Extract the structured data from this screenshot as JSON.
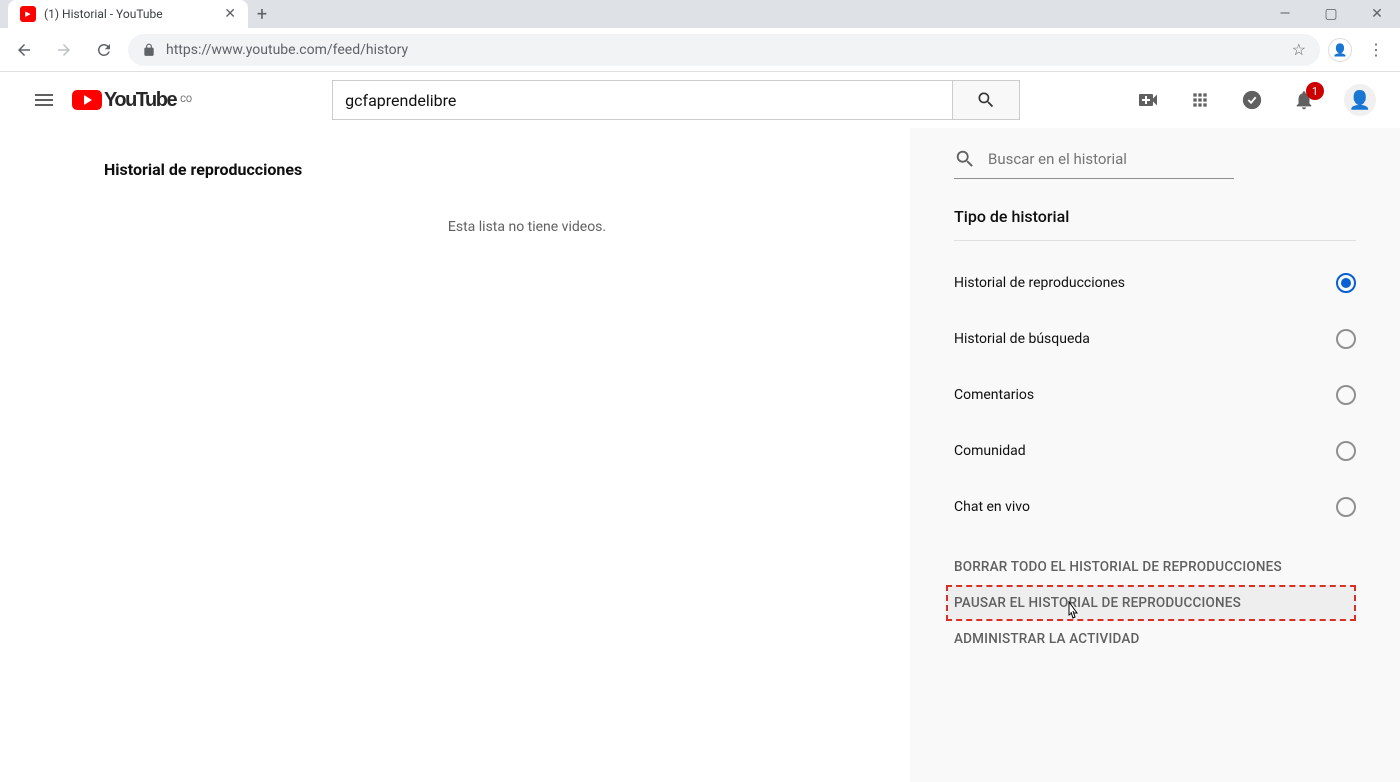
{
  "browser": {
    "tab_title": "(1) Historial - YouTube",
    "url": "https://www.youtube.com/feed/history"
  },
  "header": {
    "logo_text": "YouTube",
    "logo_cc": "CO",
    "search_value": "gcfaprendelibre",
    "notification_count": "1"
  },
  "main": {
    "title": "Historial de reproducciones",
    "empty_message": "Esta lista no tiene videos."
  },
  "sidebar": {
    "search_placeholder": "Buscar en el historial",
    "type_title": "Tipo de historial",
    "options": [
      {
        "label": "Historial de reproducciones",
        "checked": true
      },
      {
        "label": "Historial de búsqueda",
        "checked": false
      },
      {
        "label": "Comentarios",
        "checked": false
      },
      {
        "label": "Comunidad",
        "checked": false
      },
      {
        "label": "Chat en vivo",
        "checked": false
      }
    ],
    "actions": {
      "clear": "BORRAR TODO EL HISTORIAL DE REPRODUCCIONES",
      "pause": "PAUSAR EL HISTORIAL DE REPRODUCCIONES",
      "manage": "ADMINISTRAR LA ACTIVIDAD"
    }
  }
}
